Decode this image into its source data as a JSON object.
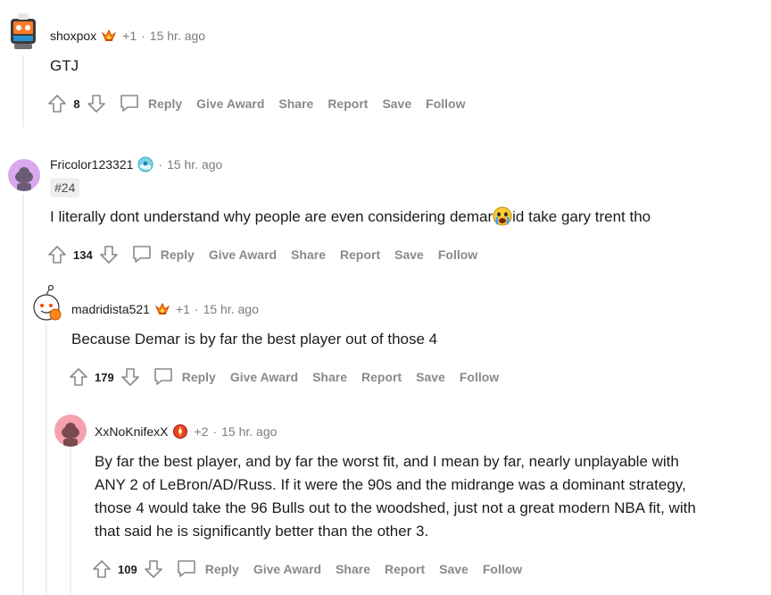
{
  "comments": [
    {
      "author": "shoxpox",
      "award_count": "+1",
      "time": "15 hr. ago",
      "flair": "",
      "body": "GTJ",
      "score": "8"
    },
    {
      "author": "Fricolor123321",
      "award_count": "",
      "time": "15 hr. ago",
      "flair": "#24",
      "body_before": "I literally dont understand why people are even considering demar",
      "body_after": "id take gary trent tho",
      "score": "134"
    },
    {
      "author": "madridista521",
      "award_count": "+1",
      "time": "15 hr. ago",
      "flair": "",
      "body": "Because Demar is by far the best player out of those 4",
      "score": "179"
    },
    {
      "author": "XxNoKnifexX",
      "award_count": "+2",
      "time": "15 hr. ago",
      "flair": "",
      "body_lines": [
        "By far the best player, and by far the worst fit, and I mean by far, nearly unplayable with",
        "ANY 2 of LeBron/AD/Russ. If it were the 90s and the midrange was a dominant strategy,",
        "those 4 would take the 96 Bulls out to the woodshed, just not a great modern NBA fit, with",
        "that said he is significantly better than the other 3."
      ],
      "score": "109"
    }
  ],
  "actions": {
    "reply": "Reply",
    "give_award": "Give Award",
    "share": "Share",
    "report": "Report",
    "save": "Save",
    "follow": "Follow"
  },
  "colors": {
    "muted": "#878a8c",
    "text": "#1c1c1c",
    "thread_line": "#edeff1"
  }
}
